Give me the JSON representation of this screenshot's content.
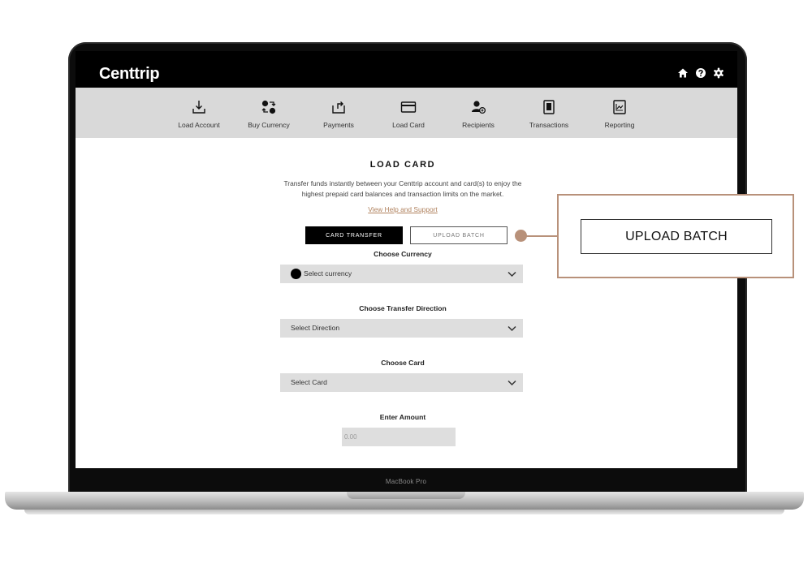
{
  "app": {
    "brand": "Centtrip",
    "header_icons": [
      "home-icon",
      "help-icon",
      "settings-icon"
    ]
  },
  "nav": {
    "items": [
      {
        "label": "Load Account",
        "icon": "download-icon"
      },
      {
        "label": "Buy Currency",
        "icon": "currency-exchange-icon"
      },
      {
        "label": "Payments",
        "icon": "upload-icon"
      },
      {
        "label": "Load Card",
        "icon": "card-icon"
      },
      {
        "label": "Recipients",
        "icon": "recipient-icon"
      },
      {
        "label": "Transactions",
        "icon": "document-icon"
      },
      {
        "label": "Reporting",
        "icon": "chart-icon"
      }
    ]
  },
  "main": {
    "title": "LOAD CARD",
    "description_line1": "Transfer funds instantly between your Centtrip account and card(s) to enjoy the",
    "description_line2": "highest prepaid card balances and transaction limits on the market.",
    "help_link": "View Help and Support",
    "tabs": [
      {
        "label": "CARD TRANSFER",
        "active": true
      },
      {
        "label": "UPLOAD BATCH",
        "active": false
      }
    ],
    "currency": {
      "label": "Choose Currency",
      "value": "Select currency"
    },
    "direction": {
      "label": "Choose Transfer Direction",
      "value": "Select Direction"
    },
    "card": {
      "label": "Choose Card",
      "value": "Select Card"
    },
    "amount": {
      "label": "Enter Amount",
      "placeholder": "0.00"
    }
  },
  "callout": {
    "label": "UPLOAD BATCH"
  },
  "device": {
    "label": "MacBook Pro"
  },
  "colors": {
    "accent": "#b0825e",
    "callout_border": "#b8917a",
    "nav_bg": "#d9d9d9",
    "field_bg": "#dedede"
  }
}
